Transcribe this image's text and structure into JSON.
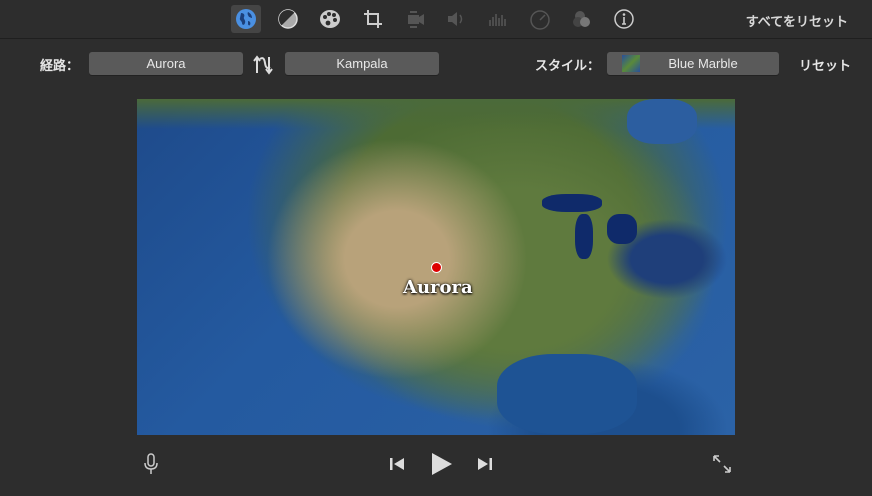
{
  "toolbar": {
    "icons": [
      "globe-icon",
      "color-balance-icon",
      "palette-icon",
      "crop-icon",
      "stabilization-icon",
      "volume-icon",
      "equalizer-icon",
      "speed-icon",
      "overlay-icon",
      "info-icon"
    ],
    "reset_all": "すべてをリセット"
  },
  "route": {
    "label": "経路：",
    "from": "Aurora",
    "to": "Kampala"
  },
  "style": {
    "label": "スタイル：",
    "value": "Blue Marble",
    "reset": "リセット"
  },
  "map": {
    "location_label": "Aurora",
    "pin_color": "#dd0000"
  }
}
